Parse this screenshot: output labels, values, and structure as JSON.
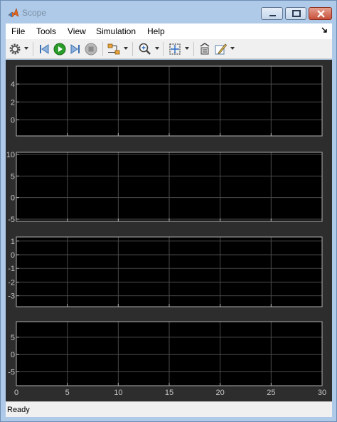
{
  "window": {
    "title": "Scope"
  },
  "menu": [
    {
      "id": "file",
      "label": "File"
    },
    {
      "id": "tools",
      "label": "Tools"
    },
    {
      "id": "view",
      "label": "View"
    },
    {
      "id": "simulation",
      "label": "Simulation"
    },
    {
      "id": "help",
      "label": "Help"
    }
  ],
  "toolbar": {
    "icons": [
      "gear-icon",
      "step-back-icon",
      "run-icon",
      "step-forward-icon",
      "stop-icon",
      "highlight-simulink-block-icon",
      "zoom-in-icon",
      "autoscale-icon",
      "restore-layout-icon",
      "edit-icon"
    ],
    "run_color": "#2a9d2a"
  },
  "chart_data": [
    {
      "type": "line",
      "xlim": [
        0,
        30
      ],
      "ylim": [
        -1.8,
        6
      ],
      "yticks": [
        "4",
        "2",
        "0"
      ],
      "ytick_values": [
        4,
        2,
        0
      ],
      "grid": true,
      "series": []
    },
    {
      "type": "line",
      "xlim": [
        0,
        30
      ],
      "ylim": [
        -5.5,
        10.5
      ],
      "yticks": [
        "10",
        "5",
        "0",
        "-5"
      ],
      "ytick_values": [
        10,
        5,
        0,
        -5
      ],
      "grid": true,
      "series": []
    },
    {
      "type": "line",
      "xlim": [
        0,
        30
      ],
      "ylim": [
        -3.8,
        1.3
      ],
      "yticks": [
        "1",
        "0",
        "-1",
        "-2",
        "-3"
      ],
      "ytick_values": [
        1,
        0,
        -1,
        -2,
        -3
      ],
      "grid": true,
      "series": []
    },
    {
      "type": "line",
      "xlim": [
        0,
        30
      ],
      "ylim": [
        -9,
        9.5
      ],
      "yticks": [
        "5",
        "0",
        "-5"
      ],
      "ytick_values": [
        5,
        0,
        -5
      ],
      "grid": true,
      "xticks": [
        "0",
        "5",
        "10",
        "15",
        "20",
        "25",
        "30"
      ],
      "xtick_values": [
        0,
        5,
        10,
        15,
        20,
        25,
        30
      ],
      "series": []
    }
  ],
  "colors": {
    "plot_bg": "#000000",
    "figure_bg": "#2d2d2d",
    "grid": "#4a4a4a",
    "axes_line": "#b0b0b0",
    "tick_text": "#c8c8c8"
  },
  "status": {
    "text": "Ready"
  }
}
